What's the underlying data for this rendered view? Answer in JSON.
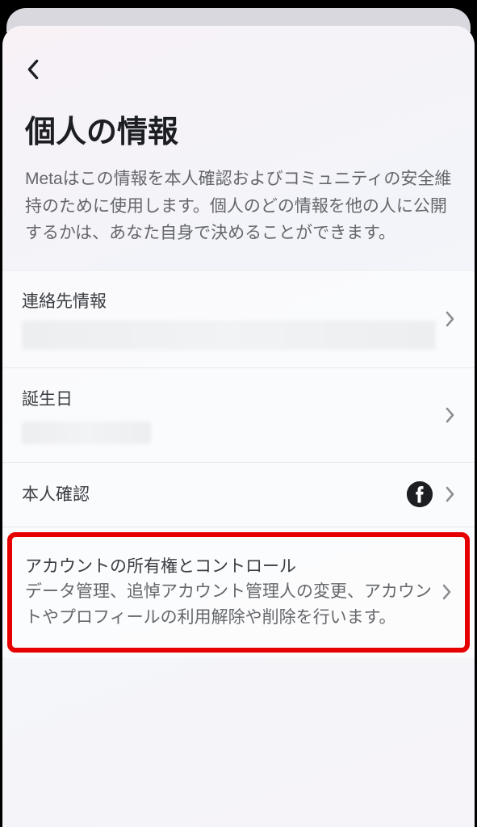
{
  "header": {
    "title": "個人の情報",
    "subtitle": "Metaはこの情報を本人確認およびコミュニティの安全維持のために使用します。個人のどの情報を他の人に公開するかは、あなた自身で決めることができます。"
  },
  "items": {
    "contact": {
      "label": "連絡先情報"
    },
    "birthday": {
      "label": "誕生日"
    },
    "identity": {
      "label": "本人確認"
    },
    "ownership": {
      "label": "アカウントの所有権とコントロール",
      "desc": "データ管理、追悼アカウント管理人の変更、アカウントやプロフィールの利用解除や削除を行います。"
    }
  }
}
